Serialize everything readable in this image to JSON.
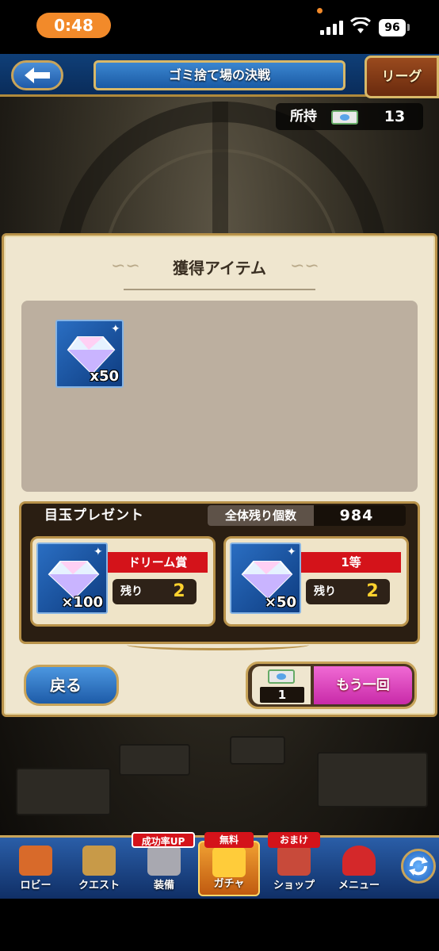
{
  "status_bar": {
    "time": "0:48",
    "battery": "96"
  },
  "header": {
    "title": "ゴミ捨て場の決戦",
    "league_label": "リーグ"
  },
  "owned": {
    "label": "所持",
    "count": "13"
  },
  "acquired": {
    "title": "獲得アイテム",
    "items": [
      {
        "icon": "gem-icon",
        "quantity": "x50"
      }
    ]
  },
  "prize": {
    "title": "目玉プレゼント",
    "remaining_label": "全体残り個数",
    "remaining_count": "984",
    "cards": [
      {
        "rank": "ドリーム賞",
        "quantity": "×100",
        "remain_label": "残り",
        "remain_count": "2"
      },
      {
        "rank": "1等",
        "quantity": "×50",
        "remain_label": "残り",
        "remain_count": "2"
      }
    ]
  },
  "buttons": {
    "back": "戻る",
    "again": "もう一回",
    "again_ticket_count": "1"
  },
  "nav": {
    "items": [
      {
        "label": "ロビー",
        "icon": "lobby-icon"
      },
      {
        "label": "クエスト",
        "icon": "quest-icon"
      },
      {
        "label": "装備",
        "icon": "equipment-icon",
        "badge": "成功率UP"
      },
      {
        "label": "ガチャ",
        "icon": "gacha-icon",
        "badge": "無料"
      },
      {
        "label": "ショップ",
        "icon": "shop-icon",
        "badge": "おまけ"
      },
      {
        "label": "メニュー",
        "icon": "menu-icon"
      }
    ]
  },
  "colors": {
    "accent_gold": "#c8a45a",
    "ribbon_red": "#d4131a",
    "again_pink": "#e04cc4",
    "nav_blue": "#2a5ea8"
  }
}
